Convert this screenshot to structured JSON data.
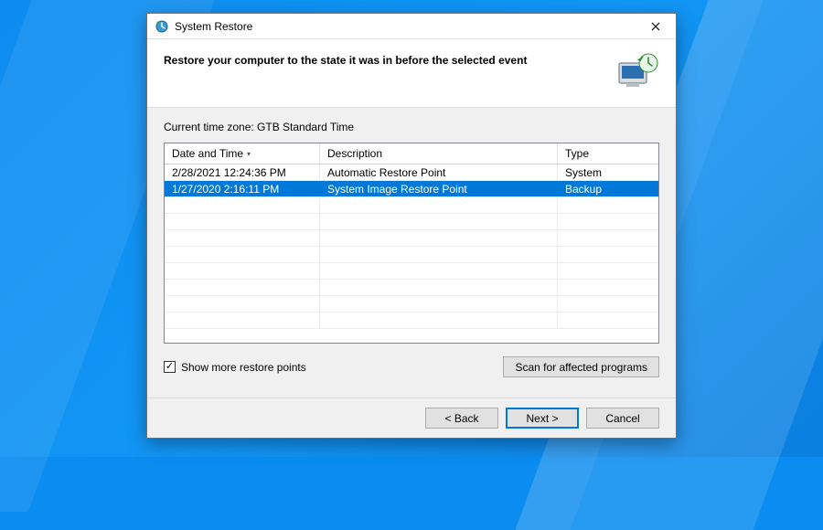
{
  "window": {
    "title": "System Restore"
  },
  "header": {
    "heading": "Restore your computer to the state it was in before the selected event"
  },
  "timezone": {
    "label": "Current time zone: GTB Standard Time"
  },
  "grid": {
    "columns": {
      "date_time": "Date and Time",
      "description": "Description",
      "type": "Type"
    },
    "rows": [
      {
        "date_time": "2/28/2021 12:24:36 PM",
        "description": "Automatic Restore Point",
        "type": "System",
        "selected": false
      },
      {
        "date_time": "1/27/2020 2:16:11 PM",
        "description": "System Image Restore Point",
        "type": "Backup",
        "selected": true
      }
    ]
  },
  "show_more": {
    "label": "Show more restore points",
    "checked": true
  },
  "scan_btn": "Scan for affected programs",
  "footer": {
    "back": "< Back",
    "next": "Next >",
    "cancel": "Cancel"
  }
}
